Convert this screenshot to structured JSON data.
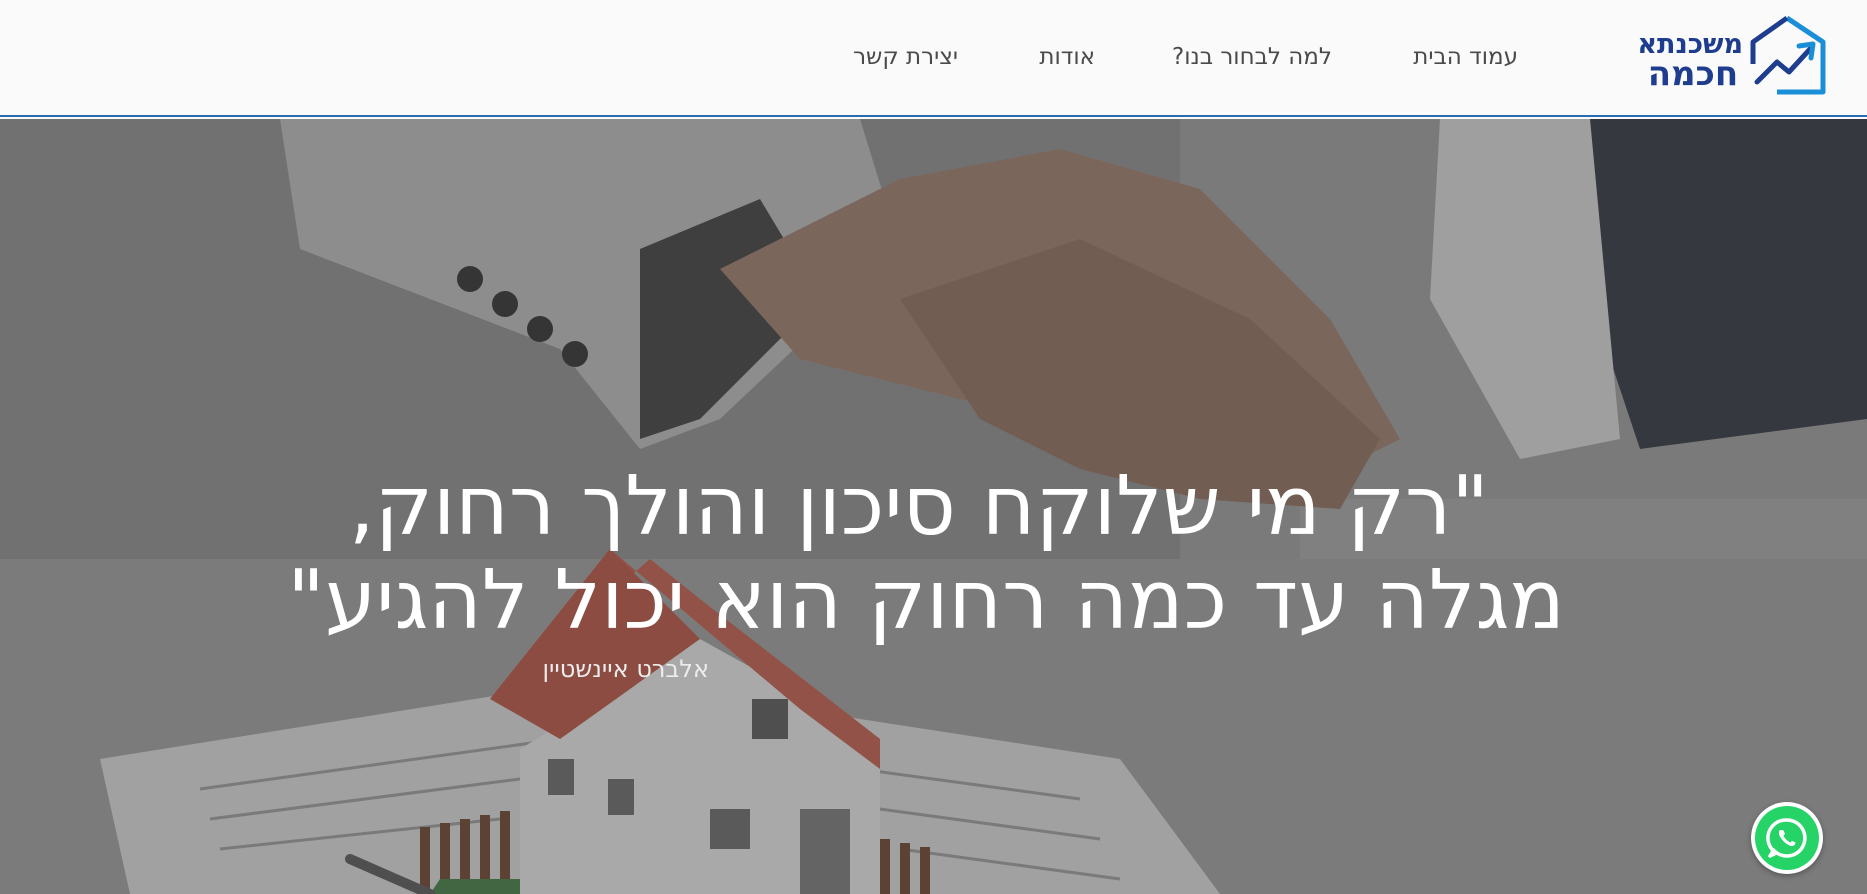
{
  "header": {
    "logo": {
      "line1": "משכנתא",
      "line2": "חכמה",
      "icon": "house-chart-icon",
      "brand_color": "#1f3d8f",
      "accent_color": "#1a8fd8"
    },
    "nav": [
      {
        "label": "עמוד הבית"
      },
      {
        "label": "למה לבחור בנו?"
      },
      {
        "label": "אודות"
      },
      {
        "label": "יצירת קשר"
      }
    ],
    "border_color": "#2b6cb0"
  },
  "hero": {
    "quote_line1": "\"רק מי שלוקח סיכון והולך רחוק,",
    "quote_line2": "מגלה עד כמה רחוק הוא יכול להגיע\"",
    "author": "אלברט איינשטיין",
    "background_image": "handshake-over-house-model"
  },
  "whatsapp": {
    "icon": "whatsapp-icon",
    "color": "#25d366"
  }
}
